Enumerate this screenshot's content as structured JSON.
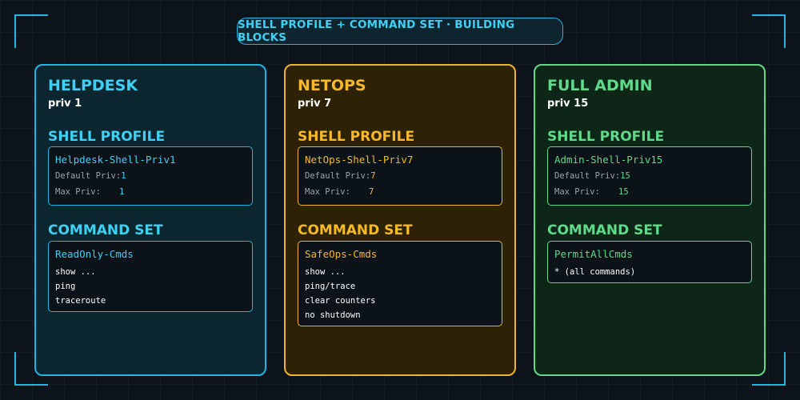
{
  "title": "SHELL PROFILE + COMMAND SET · BUILDING BLOCKS",
  "colors": {
    "cyan": "#1fb6e6",
    "amber": "#f0b429",
    "green": "#5fd98a"
  },
  "panels": [
    {
      "role": "HELPDESK",
      "priv": "priv 1",
      "shell_heading": "SHELL PROFILE",
      "shell_name": "Helpdesk-Shell-Priv1",
      "default_label": "Default Priv:",
      "default_value": "1",
      "max_label": "Max Priv:",
      "max_value": "1",
      "cmd_heading": "COMMAND SET",
      "cmd_name": "ReadOnly-Cmds",
      "commands": [
        "show ...",
        "ping",
        "traceroute"
      ]
    },
    {
      "role": "NETOPS",
      "priv": "priv 7",
      "shell_heading": "SHELL PROFILE",
      "shell_name": "NetOps-Shell-Priv7",
      "default_label": "Default Priv:",
      "default_value": "7",
      "max_label": "Max Priv:",
      "max_value": "7",
      "cmd_heading": "COMMAND SET",
      "cmd_name": "SafeOps-Cmds",
      "commands": [
        "show ...",
        "ping/trace",
        "clear counters",
        "no shutdown"
      ]
    },
    {
      "role": "FULL ADMIN",
      "priv": "priv 15",
      "shell_heading": "SHELL PROFILE",
      "shell_name": "Admin-Shell-Priv15",
      "default_label": "Default Priv:",
      "default_value": "15",
      "max_label": "Max Priv:",
      "max_value": "15",
      "cmd_heading": "COMMAND SET",
      "cmd_name": "PermitAllCmds",
      "commands": [
        "* (all commands)"
      ]
    }
  ]
}
